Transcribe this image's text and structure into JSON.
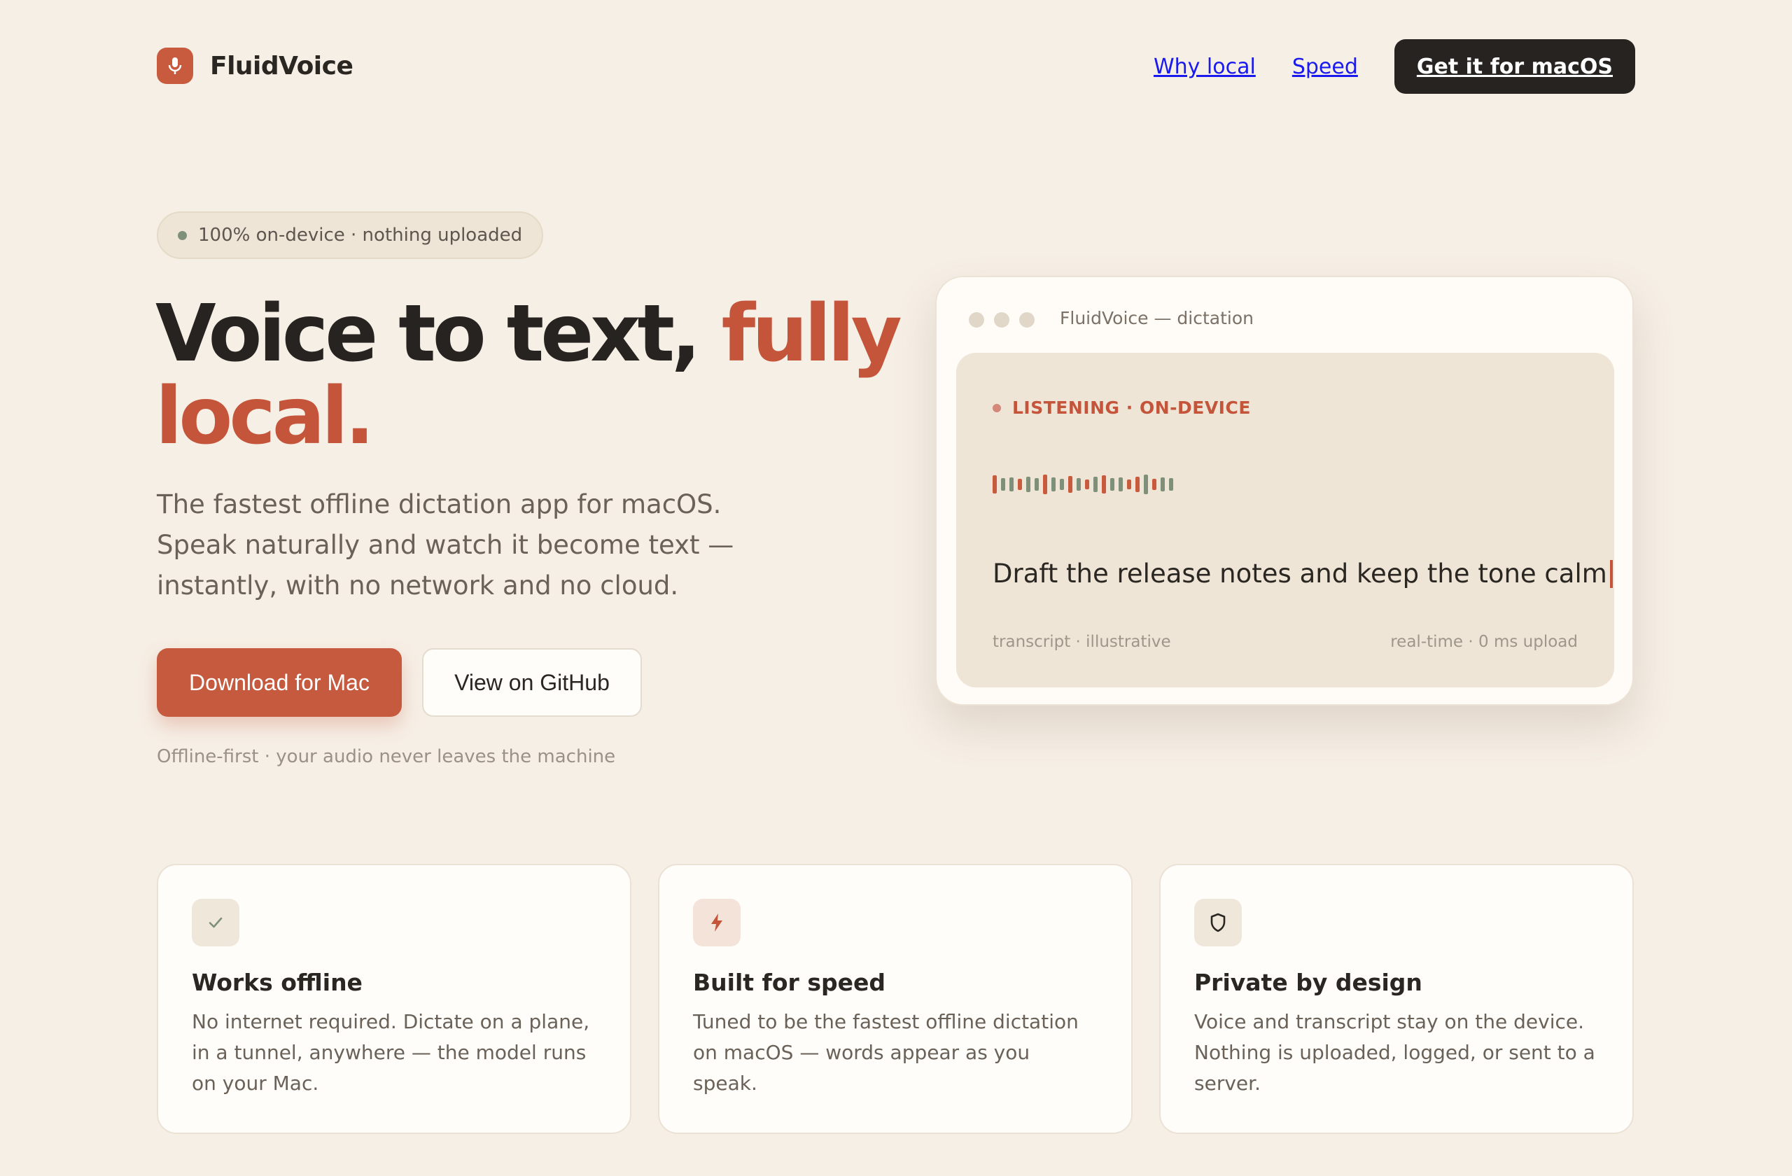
{
  "brand": {
    "name": "FluidVoice"
  },
  "nav": {
    "why_local": "Why local",
    "speed": "Speed",
    "cta": "Get it for macOS"
  },
  "hero": {
    "badge": "100% on-device · nothing uploaded",
    "headline_part1": "Voice to text,",
    "headline_accent1": "fully",
    "headline_accent2": "local.",
    "subhead": "The fastest offline dictation app for macOS. Speak naturally and watch it become text — instantly, with no network and no cloud.",
    "primary_button": "Download for Mac",
    "secondary_button": "View on GitHub",
    "footnote": "Offline-first · your audio never leaves the machine"
  },
  "window": {
    "title": "FluidVoice — dictation",
    "status": "LISTENING · ON-DEVICE",
    "transcript": "Draft the release notes and keep the tone calm",
    "meta_left": "transcript · illustrative",
    "meta_right": "real-time · 0 ms upload"
  },
  "features": [
    {
      "icon": "check-icon",
      "title": "Works offline",
      "body": "No internet required. Dictate on a plane, in a tunnel, anywhere — the model runs on your Mac."
    },
    {
      "icon": "bolt-icon",
      "title": "Built for speed",
      "body": "Tuned to be the fastest offline dictation on macOS — words appear as you speak."
    },
    {
      "icon": "shield-icon",
      "title": "Private by design",
      "body": "Voice and transcript stay on the device. Nothing is uploaded, logged, or sent to a server."
    }
  ],
  "colors": {
    "accent": "#c4553a",
    "accent_button": "#c55a3e",
    "sage": "#7e907a",
    "dark": "#272320",
    "background": "#f6efe6"
  }
}
